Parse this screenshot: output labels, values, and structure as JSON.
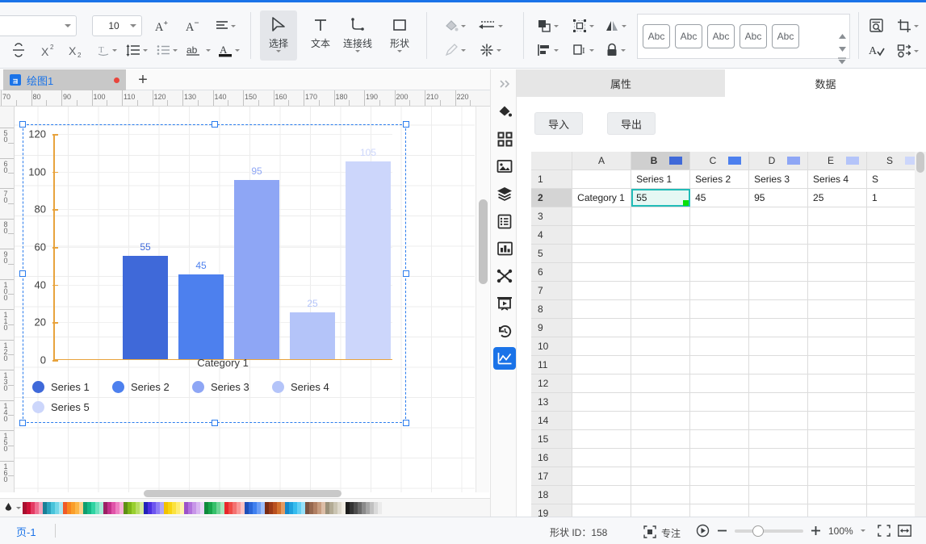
{
  "app": {
    "title": "绘图1"
  },
  "ribbon": {
    "font_name": "",
    "font_size": "10",
    "buttons": [
      {
        "name": "increase-font-size",
        "label": "A+"
      },
      {
        "name": "decrease-font-size",
        "label": "A-"
      },
      {
        "name": "paragraph-align",
        "label": "align"
      },
      {
        "name": "strikethrough",
        "label": "S"
      },
      {
        "name": "superscript",
        "label": "X²"
      },
      {
        "name": "subscript",
        "label": "X₂"
      },
      {
        "name": "text-effect",
        "label": "T"
      },
      {
        "name": "line-spacing",
        "label": "line-spacing"
      },
      {
        "name": "bullet-list",
        "label": "list"
      },
      {
        "name": "text-case",
        "label": "ab"
      },
      {
        "name": "font-color",
        "label": "A"
      }
    ],
    "tools": [
      {
        "name": "select",
        "label": "选择",
        "active": true
      },
      {
        "name": "text",
        "label": "文本",
        "active": false
      },
      {
        "name": "connector",
        "label": "连接线",
        "active": false
      },
      {
        "name": "shape",
        "label": "形状",
        "active": false
      }
    ],
    "format_buttons": [
      {
        "name": "fill-color",
        "label": "fill"
      },
      {
        "name": "line-style",
        "label": "line"
      },
      {
        "name": "pen",
        "label": "pen"
      },
      {
        "name": "effects",
        "label": "effects"
      },
      {
        "name": "arrange",
        "label": "arrange"
      },
      {
        "name": "group",
        "label": "group"
      },
      {
        "name": "align",
        "label": "align"
      },
      {
        "name": "distribute",
        "label": "distribute"
      },
      {
        "name": "flip",
        "label": "flip"
      },
      {
        "name": "lock",
        "label": "lock"
      }
    ],
    "style_gallery": [
      {
        "label": "Abc"
      },
      {
        "label": "Abc"
      },
      {
        "label": "Abc"
      },
      {
        "label": "Abc"
      },
      {
        "label": "Abc"
      }
    ],
    "right_buttons": [
      {
        "name": "find-replace",
        "label": "find"
      },
      {
        "name": "crop",
        "label": "crop"
      },
      {
        "name": "spell-check",
        "label": "spell"
      },
      {
        "name": "replace-shape",
        "label": "replace"
      }
    ]
  },
  "rulers": {
    "horizontal": [
      "70",
      "80",
      "90",
      "100",
      "110",
      "120",
      "130",
      "140",
      "150",
      "160",
      "170",
      "180",
      "190",
      "200",
      "210",
      "220"
    ],
    "vertical": [
      "50",
      "60",
      "70",
      "80",
      "90",
      "100",
      "110",
      "120",
      "130",
      "140",
      "150",
      "160"
    ]
  },
  "chart_data": {
    "type": "bar",
    "title": "",
    "xlabel": "Category 1",
    "ylabel": "",
    "categories": [
      "Category 1"
    ],
    "series_names": [
      "Series 1",
      "Series 2",
      "Series 3",
      "Series 4",
      "Series 5"
    ],
    "values": [
      55,
      45,
      95,
      25,
      105
    ],
    "data_labels": [
      "55",
      "45",
      "95",
      "25",
      "105"
    ],
    "colors": [
      "#3f69d9",
      "#4d80ee",
      "#8ea6f5",
      "#b4c4f9",
      "#ccd6fb"
    ],
    "ylim": [
      0,
      120
    ],
    "yticks": [
      0,
      20,
      40,
      60,
      80,
      100,
      120
    ],
    "ytick_labels": [
      "0",
      "20",
      "40",
      "60",
      "80",
      "100",
      "120"
    ],
    "grid": true,
    "legend": "bottom",
    "axis_color": "#e8a33d"
  },
  "right_rail": [
    {
      "name": "collapse-panel-icon",
      "active": false
    },
    {
      "name": "fill-bucket-icon",
      "active": false
    },
    {
      "name": "shape-library-icon",
      "active": false
    },
    {
      "name": "image-icon",
      "active": false
    },
    {
      "name": "layers-icon",
      "active": false
    },
    {
      "name": "document-outline-icon",
      "active": false
    },
    {
      "name": "chart-blocks-icon",
      "active": false
    },
    {
      "name": "connector-points-icon",
      "active": false
    },
    {
      "name": "presentation-icon",
      "active": false
    },
    {
      "name": "history-icon",
      "active": false
    },
    {
      "name": "chart-data-icon",
      "active": true
    }
  ],
  "panel": {
    "tabs": [
      {
        "label": "属性",
        "active": false
      },
      {
        "label": "数据",
        "active": true
      }
    ],
    "import_label": "导入",
    "export_label": "导出",
    "sheet": {
      "column_headers": [
        "A",
        "B",
        "C",
        "D",
        "E",
        "S"
      ],
      "column_chips": [
        "",
        "#3f69d9",
        "#4d80ee",
        "#8ea6f5",
        "#b4c4f9",
        "#ccd6fb"
      ],
      "selected_column": "B",
      "selected_cell": "B2",
      "rows": [
        {
          "num": "1",
          "cells": [
            "",
            "Series 1",
            "Series 2",
            "Series 3",
            "Series 4",
            "S"
          ]
        },
        {
          "num": "2",
          "cells": [
            "Category 1",
            "55",
            "45",
            "95",
            "25",
            "1"
          ]
        },
        {
          "num": "3",
          "cells": [
            "",
            "",
            "",
            "",
            "",
            ""
          ]
        },
        {
          "num": "4",
          "cells": [
            "",
            "",
            "",
            "",
            "",
            ""
          ]
        },
        {
          "num": "5",
          "cells": [
            "",
            "",
            "",
            "",
            "",
            ""
          ]
        },
        {
          "num": "6",
          "cells": [
            "",
            "",
            "",
            "",
            "",
            ""
          ]
        },
        {
          "num": "7",
          "cells": [
            "",
            "",
            "",
            "",
            "",
            ""
          ]
        },
        {
          "num": "8",
          "cells": [
            "",
            "",
            "",
            "",
            "",
            ""
          ]
        },
        {
          "num": "9",
          "cells": [
            "",
            "",
            "",
            "",
            "",
            ""
          ]
        },
        {
          "num": "10",
          "cells": [
            "",
            "",
            "",
            "",
            "",
            ""
          ]
        },
        {
          "num": "11",
          "cells": [
            "",
            "",
            "",
            "",
            "",
            ""
          ]
        },
        {
          "num": "12",
          "cells": [
            "",
            "",
            "",
            "",
            "",
            ""
          ]
        },
        {
          "num": "13",
          "cells": [
            "",
            "",
            "",
            "",
            "",
            ""
          ]
        },
        {
          "num": "14",
          "cells": [
            "",
            "",
            "",
            "",
            "",
            ""
          ]
        },
        {
          "num": "15",
          "cells": [
            "",
            "",
            "",
            "",
            "",
            ""
          ]
        },
        {
          "num": "16",
          "cells": [
            "",
            "",
            "",
            "",
            "",
            ""
          ]
        },
        {
          "num": "17",
          "cells": [
            "",
            "",
            "",
            "",
            "",
            ""
          ]
        },
        {
          "num": "18",
          "cells": [
            "",
            "",
            "",
            "",
            "",
            ""
          ]
        },
        {
          "num": "19",
          "cells": [
            "",
            "",
            "",
            "",
            "",
            ""
          ]
        }
      ]
    }
  },
  "status": {
    "page_label": "页-1",
    "shape_id": "形状 ID：158",
    "focus_label": "专注",
    "zoom_value": "100%"
  },
  "palette": {
    "colors": [
      "#a80f2e",
      "#cf1036",
      "#e43a63",
      "#ef6f92",
      "#f4a3bb",
      "#1a7f95",
      "#2ca3bd",
      "#49c3da",
      "#74d7e8",
      "#a9e7f2",
      "#f05a28",
      "#f7861f",
      "#fa9e2a",
      "#fcb648",
      "#fdd08a",
      "#0f9d6e",
      "#14b886",
      "#2fd3a2",
      "#6ee2bf",
      "#a4eed6",
      "#9b2163",
      "#c4318a",
      "#e053a8",
      "#ee80c2",
      "#f6b0da",
      "#5d8f14",
      "#7cb518",
      "#98cf2f",
      "#b7de63",
      "#d3ea9a",
      "#2222b8",
      "#4b2fe0",
      "#6d55ef",
      "#8f7ef5",
      "#b0a5f9",
      "#f2c200",
      "#f7d411",
      "#fbe23e",
      "#fdec75",
      "#fef5ab",
      "#9b52c9",
      "#b271dc",
      "#c795e8",
      "#d9b6f1",
      "#e9d6f7",
      "#0f8a3c",
      "#17a44b",
      "#35c06a",
      "#6ed495",
      "#a5e7bd",
      "#e8272b",
      "#ef4b46",
      "#f47170",
      "#f89a99",
      "#fbc2c2",
      "#1d4fb8",
      "#2a66d8",
      "#3f80ef",
      "#6b9ef5",
      "#9dbefa",
      "#7a2b12",
      "#9b3a17",
      "#b9501f",
      "#d3722f",
      "#e49b62",
      "#1587c9",
      "#1fa1dd",
      "#35bcee",
      "#63cff4",
      "#97e0f8",
      "#7a5341",
      "#96684f",
      "#b07f62",
      "#c79d80",
      "#dcbda6",
      "#9a9079",
      "#b3ab95",
      "#cac4b2",
      "#ded9cc",
      "#f0ece3",
      "#1c1c1c",
      "#333333",
      "#4d4d4d",
      "#696969",
      "#8a8a8a",
      "#a6a6a6",
      "#c1c1c1",
      "#d9d9d9",
      "#ebebeb",
      "#f7f7f7"
    ]
  }
}
